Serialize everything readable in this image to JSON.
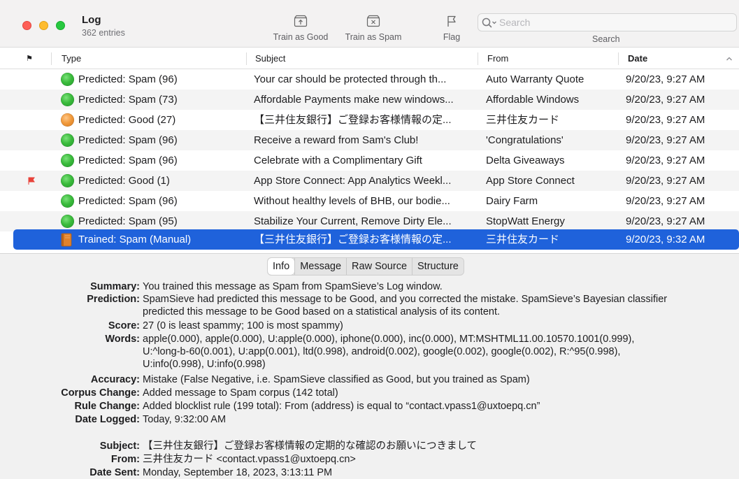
{
  "window": {
    "title": "Log",
    "subtitle": "362 entries"
  },
  "toolbar": {
    "train_good_label": "Train as Good",
    "train_spam_label": "Train as Spam",
    "flag_label": "Flag",
    "search_label": "Search",
    "search_placeholder": "Search"
  },
  "columns": {
    "flag": "⚑",
    "type": "Type",
    "subject": "Subject",
    "from": "From",
    "date": "Date",
    "sorted_by": "Date",
    "sort_direction": "ascending"
  },
  "rows": [
    {
      "status": "green",
      "flagged": false,
      "type": "Predicted: Spam (96)",
      "subject": "Your car should be protected through th...",
      "from": "Auto Warranty Quote",
      "date": "9/20/23, 9:27 AM"
    },
    {
      "status": "green",
      "flagged": false,
      "type": "Predicted: Spam (73)",
      "subject": "Affordable Payments make new windows...",
      "from": "Affordable Windows",
      "date": "9/20/23, 9:27 AM"
    },
    {
      "status": "orange",
      "flagged": false,
      "type": "Predicted: Good (27)",
      "subject": "【三井住友銀行】ご登録お客様情報の定...",
      "from": "三井住友カード",
      "date": "9/20/23, 9:27 AM"
    },
    {
      "status": "green",
      "flagged": false,
      "type": "Predicted: Spam (96)",
      "subject": "Receive a reward from Sam's Club!",
      "from": "'Congratulations'",
      "date": "9/20/23, 9:27 AM"
    },
    {
      "status": "green",
      "flagged": false,
      "type": "Predicted: Spam (96)",
      "subject": "Celebrate with a Complimentary Gift",
      "from": "Delta Giveaways",
      "date": "9/20/23, 9:27 AM"
    },
    {
      "status": "green",
      "flagged": true,
      "type": "Predicted: Good (1)",
      "subject": "App Store Connect: App Analytics Weekl...",
      "from": "App Store Connect",
      "date": "9/20/23, 9:27 AM"
    },
    {
      "status": "green",
      "flagged": false,
      "type": "Predicted: Spam (96)",
      "subject": "Without healthy levels of BHB, our bodie...",
      "from": "Dairy Farm",
      "date": "9/20/23, 9:27 AM"
    },
    {
      "status": "green",
      "flagged": false,
      "type": "Predicted: Spam (95)",
      "subject": "Stabilize Your Current, Remove Dirty Ele...",
      "from": "StopWatt Energy",
      "date": "9/20/23, 9:27 AM"
    },
    {
      "status": "book",
      "flagged": false,
      "selected": true,
      "type": "Trained: Spam (Manual)",
      "subject": "【三井住友銀行】ご登録お客様情報の定...",
      "from": "三井住友カード",
      "date": "9/20/23, 9:32 AM"
    }
  ],
  "detail_tabs": [
    "Info",
    "Message",
    "Raw Source",
    "Structure"
  ],
  "active_tab": "Info",
  "info": {
    "summary_label": "Summary:",
    "summary": "You trained this message as Spam from SpamSieve’s Log window.",
    "prediction_label": "Prediction:",
    "prediction": "SpamSieve had predicted this message to be Good, and you corrected the mistake. SpamSieve’s Bayesian classifier\npredicted this message to be Good based on a statistical analysis of its content.",
    "score_label": "Score:",
    "score": "27 (0 is least spammy; 100 is most spammy)",
    "words_label": "Words:",
    "words": "apple(0.000), apple(0.000), U:apple(0.000), iphone(0.000), inc(0.000), MT:MSHTML11.00.10570.1001(0.999),\nU:^long-b-60(0.001), U:app(0.001), ltd(0.998), android(0.002), google(0.002), google(0.002), R:^95(0.998),\nU:info(0.998), U:info(0.998)",
    "accuracy_label": "Accuracy:",
    "accuracy": "Mistake (False Negative, i.e. SpamSieve classified as Good, but you trained as Spam)",
    "corpus_label": "Corpus Change:",
    "corpus": "Added message to Spam corpus (142 total)",
    "rule_label": "Rule Change:",
    "rule": "Added blocklist rule (199 total): From (address) is equal to “contact.vpass1@uxtoepq.cn”",
    "logged_label": "Date Logged:",
    "logged": "Today, 9:32:00 AM",
    "subject_label": "Subject:",
    "subject": "【三井住友銀行】ご登録お客様情報の定期的な確認のお願いにつきまして",
    "from_label": "From:",
    "from": "三井住友カード <contact.vpass1@uxtoepq.cn>",
    "sent_label": "Date Sent:",
    "sent": "Monday, September 18, 2023, 3:13:11 PM"
  },
  "colors": {
    "selection": "#1f62db",
    "flag": "#e8423a",
    "spam_dot": "#34b53a",
    "good_dot": "#f0953a"
  }
}
